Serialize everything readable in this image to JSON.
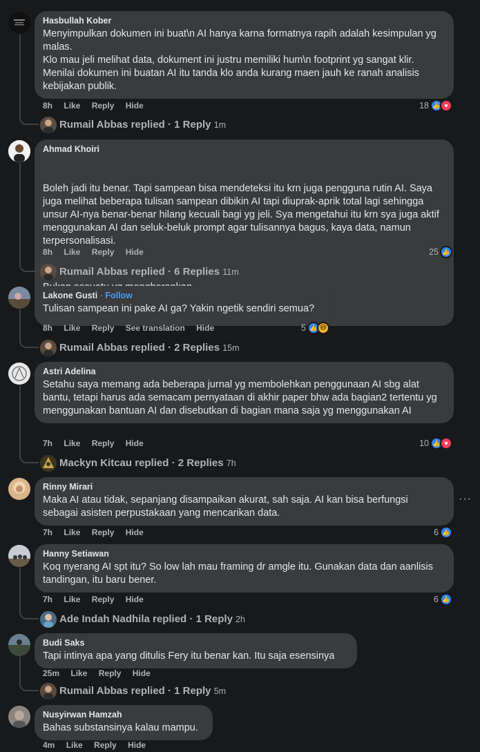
{
  "comments": [
    {
      "author": "Hasbullah Kober",
      "text": "Menyimpulkan dokumen ini buat\\n AI hanya karna formatnya rapih adalah kesimpulan yg malas.\nKlo mau jeli melihat data, dokument ini justru memiliki hum\\n footprint yg sangat klir.\nMenilai dokumen ini buatan AI itu tanda klo anda kurang maen jauh ke ranah analisis kebijakan publik.",
      "time": "8h",
      "like": "Like",
      "reply": "Reply",
      "hide": "Hide",
      "reaction_count": "18",
      "reactions": [
        "like",
        "love"
      ],
      "replied": {
        "name": "Rumail Abbas",
        "verb": "replied",
        "count": "1 Reply",
        "time": "1m"
      }
    },
    {
      "author": "Ahmad Khoiri",
      "text_p1": "Boleh jadi itu benar. Tapi sampean bisa mendeteksi itu krn juga pengguna rutin AI. Saya juga melihat beberapa tulisan sampean dibikin AI tapi diuprak-aprik total lagi sehingga unsur AI-nya benar-benar hilang kecuali bagi yg jeli. Sya mengetahui itu krn sya juga aktif menggunakan AI dan seluk-beluk prompt agar tulisannya bagus, kaya data, namun terpersonalisasi.",
      "text_p2": "Bukan sesuatu yg mengherankan.",
      "time": "8h",
      "like": "Like",
      "reply": "Reply",
      "hide": "Hide",
      "reaction_count": "25",
      "reactions": [
        "like"
      ],
      "replied": {
        "name": "Rumail Abbas",
        "verb": "replied",
        "count": "6 Replies",
        "time": "11m"
      }
    },
    {
      "author": "Lakone Gusti",
      "follow": "Follow",
      "text": "Tulisan sampean ini pake AI ga? Yakin ngetik sendiri semua?",
      "time": "8h",
      "like": "Like",
      "reply": "Reply",
      "translate": "See translation",
      "hide": "Hide",
      "reaction_count": "5",
      "reactions": [
        "like",
        "haha"
      ],
      "replied": {
        "name": "Rumail Abbas",
        "verb": "replied",
        "count": "2 Replies",
        "time": "15m"
      }
    },
    {
      "author": "Astri Adelina",
      "text": "Setahu saya memang ada beberapa jurnal yg membolehkan penggunaan AI sbg alat bantu, tetapi harus ada semacam pernyataan di akhir paper bhw ada bagian2 tertentu yg menggunakan bantuan AI dan disebutkan di bagian mana saja yg menggunakan AI",
      "time": "7h",
      "like": "Like",
      "reply": "Reply",
      "hide": "Hide",
      "reaction_count": "10",
      "reactions": [
        "like",
        "love"
      ],
      "replied": {
        "name": "Mackyn Kitcau",
        "verb": "replied",
        "count": "2 Replies",
        "time": "7h"
      }
    },
    {
      "author": "Rinny Mirari",
      "text": "Maka AI atau tidak, sepanjang disampaikan akurat, sah saja. AI kan bisa berfungsi sebagai asisten perpustakaan yang mencarikan data.",
      "time": "7h",
      "like": "Like",
      "reply": "Reply",
      "hide": "Hide",
      "reaction_count": "6",
      "reactions": [
        "like"
      ],
      "more": "···"
    },
    {
      "author": "Hanny Setiawan",
      "text": "Koq nyerang AI spt itu? So low lah mau framing dr amgle itu. Gunakan data dan aanlisis tandingan, itu baru bener.",
      "time": "7h",
      "like": "Like",
      "reply": "Reply",
      "hide": "Hide",
      "reaction_count": "6",
      "reactions": [
        "like"
      ],
      "replied": {
        "name": "Ade Indah Nadhila",
        "verb": "replied",
        "count": "1 Reply",
        "time": "2h"
      }
    },
    {
      "author": "Budi Saks",
      "text": "Tapi intinya apa yang ditulis Fery itu benar kan. Itu saja esensinya",
      "time": "25m",
      "like": "Like",
      "reply": "Reply",
      "hide": "Hide",
      "replied": {
        "name": "Rumail Abbas",
        "verb": "replied",
        "count": "1 Reply",
        "time": "5m"
      }
    },
    {
      "author": "Nusyirwan Hamzah",
      "text": "Bahas substansinya kalau mampu.",
      "time": "4m",
      "like": "Like",
      "reply": "Reply",
      "hide": "Hide"
    }
  ],
  "colors": {
    "like": "#2d86ff",
    "love": "#f33e58",
    "haha": "#f7b125",
    "bubble": "#3a3b3c",
    "background": "#18191a"
  },
  "icons": {
    "like": "thumbs-up-icon",
    "love": "heart-icon",
    "haha": "laughing-face-icon",
    "more": "more-options-icon"
  }
}
